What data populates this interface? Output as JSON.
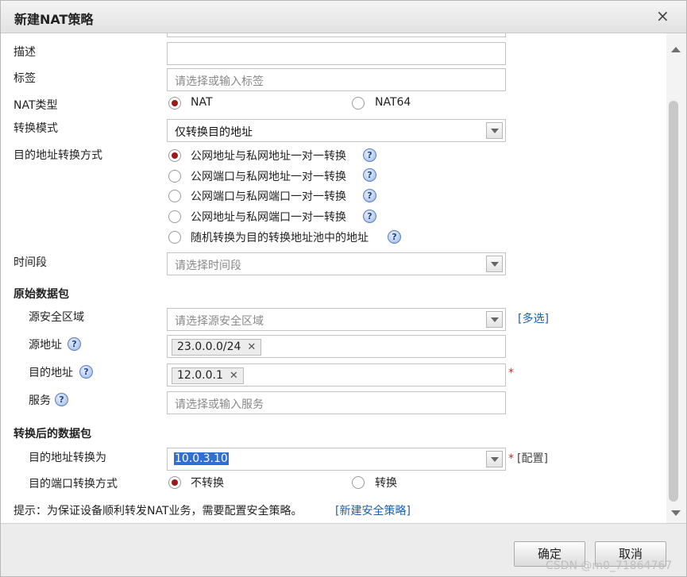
{
  "dialog": {
    "title": "新建NAT策略",
    "close_label": "×"
  },
  "form": {
    "description": {
      "label": "描述",
      "value": ""
    },
    "tags": {
      "label": "标签",
      "placeholder": "请选择或输入标签"
    },
    "nat_type": {
      "label": "NAT类型",
      "options": [
        "NAT",
        "NAT64"
      ],
      "selected": "NAT"
    },
    "mode": {
      "label": "转换模式",
      "value": "仅转换目的地址"
    },
    "dest_method": {
      "label": "目的地址转换方式",
      "options": [
        "公网地址与私网地址一对一转换",
        "公网端口与私网地址一对一转换",
        "公网端口与私网端口一对一转换",
        "公网地址与私网端口一对一转换",
        "随机转换为目的转换地址池中的地址"
      ],
      "selected_index": 0
    },
    "time_range": {
      "label": "时间段",
      "placeholder": "请选择时间段"
    }
  },
  "original_packet": {
    "section_title": "原始数据包",
    "src_zone": {
      "label": "源安全区域",
      "placeholder": "请选择源安全区域",
      "multi_link": "[多选]"
    },
    "src_addr": {
      "label": "源地址",
      "tags": [
        "23.0.0.0/24"
      ]
    },
    "dst_addr": {
      "label": "目的地址",
      "tags": [
        "12.0.0.1"
      ],
      "required_mark": "*"
    },
    "service": {
      "label": "服务",
      "placeholder": "请选择或输入服务"
    }
  },
  "translated_packet": {
    "section_title": "转换后的数据包",
    "dst_translate": {
      "label": "目的地址转换为",
      "value": "10.0.3.10",
      "required_mark": "*",
      "config_link": "[配置]"
    },
    "port_method": {
      "label": "目的端口转换方式",
      "options": [
        "不转换",
        "转换"
      ],
      "selected": "不转换"
    }
  },
  "hint": {
    "text": "提示：为保证设备顺利转发NAT业务，需要配置安全策略。",
    "link": "[新建安全策略]"
  },
  "footer": {
    "ok_label": "确定",
    "cancel_label": "取消"
  },
  "watermark": "CSDN @m0_71864767",
  "icons": {
    "help": "help-icon",
    "close": "close-icon",
    "dropdown": "chevron-down-icon"
  },
  "colors": {
    "radio_selected": "#9b1b1b",
    "link": "#1a5fb4",
    "required": "#dd2222",
    "selection": "#2f6fd6"
  }
}
